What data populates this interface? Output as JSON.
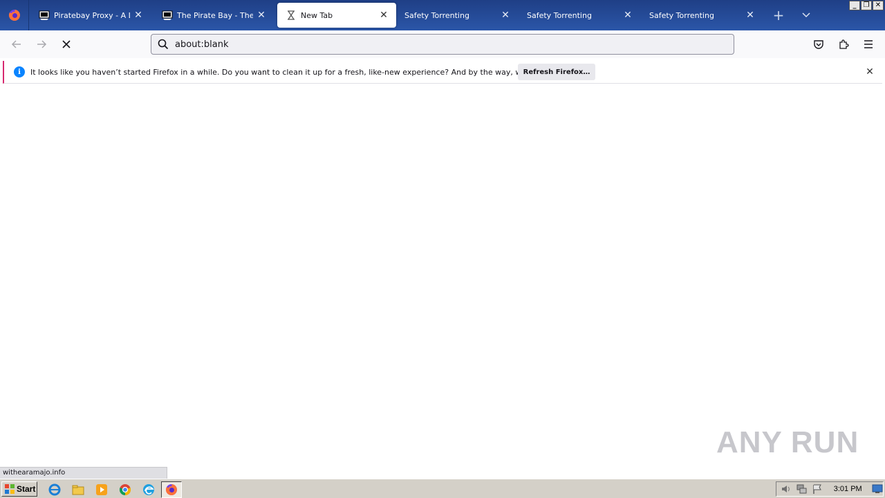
{
  "browser": {
    "tabs": [
      {
        "title": "Piratebay Proxy - A List of",
        "favicon": "pirate-ship-icon",
        "active": false
      },
      {
        "title": "The Pirate Bay - The galaxy",
        "favicon": "pirate-ship-icon",
        "active": false
      },
      {
        "title": "New Tab",
        "favicon": "hourglass-loading-icon",
        "active": true
      },
      {
        "title": "Safety Torrenting",
        "favicon": "",
        "active": false
      },
      {
        "title": "Safety Torrenting",
        "favicon": "",
        "active": false
      },
      {
        "title": "Safety Torrenting",
        "favicon": "",
        "active": false
      }
    ],
    "url": "about:blank",
    "notification": {
      "message": "It looks like you haven’t started Firefox in a while. Do you want to clean it up for a fresh, like-new experience? And by the way, welcome back!",
      "button_label": "Refresh Firefox…"
    },
    "status_text": "withearamajo.info"
  },
  "watermark": {
    "left": "ANY",
    "right": "RUN"
  },
  "taskbar": {
    "start_label": "Start",
    "clock": "3:01 PM",
    "pinned": [
      "internet-explorer-icon",
      "windows-explorer-icon",
      "media-player-icon",
      "chrome-icon",
      "edge-icon",
      "firefox-icon"
    ]
  },
  "colors": {
    "tabstrip": "#2b56a8",
    "accent": "#0a84ff",
    "notification_border": "#d7286f"
  }
}
